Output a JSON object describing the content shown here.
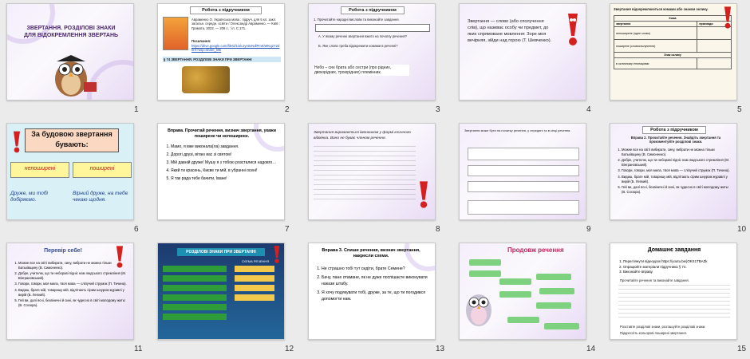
{
  "slides": [
    {
      "n": "1",
      "title": "ЗВЕРТАННЯ. РОЗДІЛОВІ ЗНАКИ ДЛЯ ВІДОКРЕМЛЕННЯ ЗВЕРТАНЬ"
    },
    {
      "n": "2",
      "header": "Робота з підручником",
      "book": "Авраменко О. Українська мова : підруч. для 5 кл. закл. загальн. середн. освіти / Олександр Авраменко. — Київ : Грамота, 2022. — 208 с. : іл. С.171.",
      "link_label": "Посилання:",
      "link": "https://drive.google.com/file/d/1iolcJyn0xNdlPmKiWKq2Y2d0rX?usp=share_link",
      "section": "§ 74  ЗВЕРТАННЯ. РОЗДІЛОВІ ЗНАКИ ПРИ ЗВЕРТАННІ"
    },
    {
      "n": "3",
      "header": "Робота з підручником",
      "task": "1. Прочитайте народні вислови та виконайте завдання.",
      "q1": "А. У якому реченні звертання вжито на початку речення?",
      "q2": "Б. Яке слово треба відокремити комами в реченні?",
      "answer": "Небо – син брата або сестри (про рідних, двоюрідних, троюрідних) племінник."
    },
    {
      "n": "4",
      "text": "Звертання — слово (або сполучення слів), що називає особу чи предмет, до яких спрямоване мовлення: Зоре моя вечірняя, зійди над горою (Т. Шевченко)."
    },
    {
      "n": "5",
      "title": "Звертання відокремлюються комами або знаком оклику.",
      "col_a": "звертання",
      "col_b": "приклади",
      "col_c": "Кома",
      "row1": "непоширене (одне слово)",
      "row2": "поширене (словосполучення)",
      "row3": "в окличному інтонаціями",
      "col_d": "Знак оклику"
    },
    {
      "n": "6",
      "title": "За будовою звертання бувають:",
      "left": "непоширені",
      "right": "поширені",
      "left_ex": "Друже, ми тобі добіряємо.",
      "right_ex": "Вірний друже, на тебе чекаю щодня."
    },
    {
      "n": "7",
      "header": "Вправа. Прочитай речення, визнач звертання, укажи поширене чи непоширене.",
      "items": [
        "Мамо, я вже виконала(ла) завдання.",
        "Дорогі друзі, вітаю вас зі святом!",
        "Мій давній друже! Мушу я з тобою розсталися надовго…",
        "Який ти красень, Києве ти мій, в убранні осені!",
        "Я так рада тебе бачити, Іване!"
      ]
    },
    {
      "n": "8",
      "text": "Звертання виражається іменником у формі кличного відмінка. Воно не буває членом речення."
    },
    {
      "n": "9",
      "text": "Звертання може бути на початку речення, у середині та в кінці речення."
    },
    {
      "n": "10",
      "header": "Робота з підручником",
      "sub": "Вправа 2. Прочитайте речення. Знайдіть звертання та прокоментуйте розділові знаки.",
      "items": [
        "Можне все на світі вибирати, сину, вибрати не можна тільки Батьківщину (В. Симоненко).",
        "Добре, учителю, що ти небораві підніс нам людського стремління (М. Вінграновський).",
        "Говори, говори, моя мила, твоя мова — сліпучий струмок (П. Тичина).",
        "Видиш, брате мій, товаришу мій, відлітають сірим шнуром журавлі у вирій (Б. Лепкий).",
        "Гей ви, далі ясні, безвінечні й сині, як чудесно в світі молодому жить! (В. Сосюра)."
      ]
    },
    {
      "n": "11",
      "header": "Перевір себе!",
      "items": [
        "Можне все на світі вибирати, сину, вибрати не можна тільки Батьківщину (В. Симоненко).",
        "Добре, учителю, що ти небораві підніс нам людського стремління (М. Вінграновський).",
        "Говори, говори, моя мила, твоя мова — сліпучий струмок (П. Тичина).",
        "Видиш, брате мій, товаришу мій, відлітають сірим шнуром журавлі у вирій (Б. Лепкий).",
        "Гей ви, далі ясні, безвінечні й сині, як чудесно в світі молодому жить! (В. Сосюра)."
      ]
    },
    {
      "n": "12",
      "header": "РОЗДІЛОВІ ЗНАКИ ПРИ ЗВЕРТАННІ",
      "scheme": "СХЕМА РЕЧЕННЯ"
    },
    {
      "n": "13",
      "header": "Вправа 3. Спиши речення, визнач звертання, накресли схеми.",
      "items": [
        "Не страшно тобі тут сидіти, брате Семене?",
        "Бачу, пане отамане, як не дуже поспішаєте виконувати накази штабу.",
        "Я хочу подякувати тобі, друже, за те, що ти погодився допомогти нам."
      ]
    },
    {
      "n": "14",
      "title": "Продовж речення"
    },
    {
      "n": "15",
      "header": "Домашнє завдання",
      "items": [
        "Переглянути відеоурок https://youtu.be/jOKS1TBAZk",
        "Опрацюйте матеріали підручника § 74.",
        "Виконайте вправу."
      ],
      "task_label": "Прочитайте речення та виконайте завдання.",
      "bottom1": "Розставте розділові знаки, розташуйте розділові знаки.",
      "bottom2": "Підкресліть кольорові поширені звертання."
    }
  ]
}
